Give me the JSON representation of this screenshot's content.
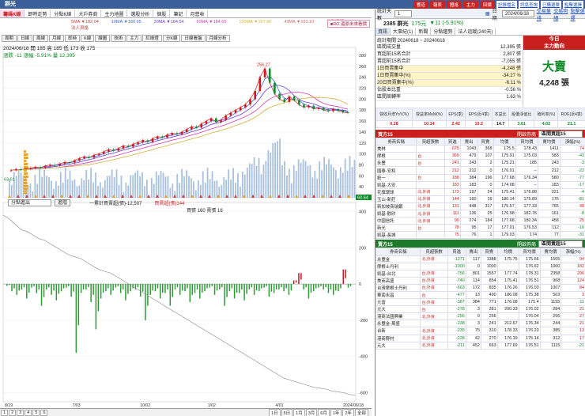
{
  "window": {
    "title": "群光"
  },
  "top_menu": {
    "buttons": [
      "響道",
      "報表",
      "體格",
      "主力",
      "回饋"
    ],
    "links": [
      "記錄檔名",
      "訊息查詢",
      "已購選單",
      "點擊選擇"
    ]
  },
  "tabs": [
    "籌碼K線",
    "即時走勢",
    "分點K線",
    "大戶券商",
    "主力地圖",
    "選股分析",
    "個股",
    "筆記",
    "月營收"
  ],
  "ma_legend": [
    {
      "label": "5MA ▼182.04",
      "color": "#d43a3a"
    },
    {
      "label": "10MA ▼180.95",
      "color": "#3a6ad4"
    },
    {
      "label": "20MA ▼184.54",
      "color": "#6a3ad4"
    },
    {
      "label": "60MA ▼184.65",
      "color": "#d43ab0"
    },
    {
      "label": "120MA ▼167.60",
      "color": "#d4b03a"
    },
    {
      "label": "43MA ▼183.10",
      "color": "#c86a6a"
    },
    {
      "label": "地點選擇",
      "color": "#c04040"
    },
    {
      "label": "法人資格",
      "color": "#c04040"
    }
  ],
  "ma_badge": "■RO 還原未來看價",
  "tools": [
    "周期",
    "日線",
    "周線",
    "月線",
    "即時",
    "K線",
    "線圖",
    "技術",
    "主力",
    "紅綠燈",
    "分K線",
    "日線看盤",
    "月線分析"
  ],
  "info": {
    "line1": "2024/06/18 開 185 高 185 低 173 收 175",
    "line2_prefix": "漲跌 -11 漲幅 -5.91% 量 12,395"
  },
  "chart_data": {
    "type": "line",
    "title": "",
    "x_ticks": [
      "8/19",
      "7/03",
      "10/02",
      "1/02",
      "4/01",
      "2024/06/18"
    ],
    "x_tick_year": [
      "2023",
      "",
      "",
      "2024",
      "",
      ""
    ],
    "y_ticks_price": [
      280,
      260,
      240,
      220,
      200,
      180,
      160,
      140,
      120,
      100,
      80,
      60,
      40,
      20
    ],
    "y_ticks_flow": [
      400,
      200,
      0,
      -200,
      -400,
      -600
    ],
    "peak_label": "256.27",
    "low_label": "63.51",
    "last_label": "60.64",
    "price": [
      70,
      72,
      71,
      73,
      74,
      76,
      75,
      78,
      80,
      79,
      82,
      85,
      84,
      88,
      92,
      95,
      93,
      98,
      100,
      104,
      108,
      106,
      110,
      115,
      113,
      118,
      121,
      125,
      122,
      128,
      132,
      130,
      135,
      138,
      136,
      140,
      145,
      150,
      148,
      155,
      160,
      165,
      158,
      162,
      170,
      175,
      180,
      185,
      190,
      200,
      215,
      240,
      256,
      230,
      210,
      200,
      195,
      205,
      198,
      190,
      185,
      188,
      182,
      184,
      180,
      178,
      182,
      179,
      176,
      175
    ],
    "volume_in_price_pane": true,
    "flow_label": "一累計買賣超(張)-12,507",
    "flow_sub": "買張 160 賣張 16",
    "flow_series": "買賣超(張)144",
    "cum_flow": [
      380,
      360,
      330,
      300,
      290,
      270,
      250,
      240,
      220,
      200,
      180,
      160,
      150,
      140,
      120,
      100,
      80,
      70,
      60,
      40,
      20,
      0,
      -20,
      -40,
      -60,
      -80,
      -100,
      -120,
      -140,
      -160,
      -180,
      -200,
      -220,
      -240,
      -260,
      -280,
      -300,
      -320,
      -340,
      -360,
      -380,
      -400,
      -420,
      -440,
      -460,
      -480,
      -500,
      -520,
      -530,
      -540,
      -550,
      -560,
      -570,
      -575,
      -580,
      -590,
      -595,
      -600,
      -610,
      -615
    ],
    "daily_flow": [
      -10,
      -40,
      -60,
      -30,
      -80,
      -20,
      -50,
      -120,
      -30,
      -60,
      -90,
      -40,
      -20,
      -70,
      -380,
      -50,
      -30,
      -100,
      -250,
      -80,
      -40,
      -60,
      -20,
      -50,
      -90,
      -40,
      -30,
      -70,
      -200,
      -60,
      -40,
      -80,
      -50,
      -120,
      -30,
      -60,
      -40,
      -100,
      -50,
      -80,
      -40,
      -20,
      -60,
      -30,
      -120,
      -40,
      -80,
      -50,
      -90,
      -30,
      -60,
      -40,
      -20,
      -70,
      -50,
      -30,
      -40,
      -60,
      20,
      60,
      -30,
      -80,
      -40,
      -20,
      -30,
      -50,
      -60,
      -40,
      80,
      -20
    ]
  },
  "indicator_select": "分點進出",
  "indicator_btn": "進階",
  "bottom_pages": [
    "1",
    "2",
    "3",
    "4",
    "5",
    "6"
  ],
  "bottom_right": [
    "1日",
    "5日",
    "1月",
    "3月",
    "6月",
    "1年",
    "2年",
    "全部"
  ],
  "right": {
    "stats_label": "統計天數",
    "stats_days": "1",
    "date_label": "日期",
    "date_value": "2024/06/18",
    "links": [
      "交易量排",
      "交易明細",
      "點擊選擇"
    ],
    "stock_title": "2385 群光",
    "stock_price": "175元",
    "stock_change": "▼11 (-5.91%)",
    "sub_tabs": [
      "資訊",
      "大事紀(1)",
      "新聞",
      "分點趨勢",
      "法人追蹤(240天)"
    ],
    "summary_head": "統計期間  20240618 ~ 20240618",
    "summary": [
      {
        "label": "區間成交量",
        "value": "12,395 張"
      },
      {
        "label": "買超前15名合計",
        "value": "2,807 張"
      },
      {
        "label": "賣超前15名合計",
        "value": "-7,055 張"
      },
      {
        "label": "1日買賣集中",
        "value": "-4,248 張"
      },
      {
        "label": "1日買賣集中(%)",
        "value": "-34.27 %"
      },
      {
        "label": "20日買賣集中(%)",
        "value": "-6.11 %"
      },
      {
        "label": "佔股本比重",
        "value": "-0.56 %"
      },
      {
        "label": "區間周轉率",
        "value": "1.63 %"
      }
    ],
    "today_label": "今日",
    "main_label": "主力動向",
    "verdict": "大賣",
    "verdict_value": "4,248 張",
    "metrics_heads": [
      "營收月增YoY(%)",
      "營益率MoM(%)",
      "EPS(季)",
      "EPS(近4季)",
      "本益比",
      "股價淨值比",
      "殖利率(%)",
      "ROE(近4季)"
    ],
    "metrics_values": [
      "0.28",
      "10.14",
      "2.42",
      "10.2",
      "14.7",
      "3.61",
      "4.02",
      "21.1"
    ],
    "buy_title": "買方15",
    "sell_title": "賣方15",
    "select_label": "開啟券商",
    "select_value": "區間買超15",
    "select_value_sell": "區間賣超15",
    "table_heads": [
      "券商名稱",
      "買超張數",
      "買進",
      "賣出",
      "買賣",
      "均價",
      "買均價",
      "賣均價",
      "漲幅(%)"
    ],
    "buys": [
      [
        "美林",
        "",
        "675",
        "1043",
        "368",
        "175.5",
        "178.43",
        "1411",
        "74"
      ],
      [
        "摩根",
        "台",
        "369",
        "479",
        "107",
        "175.91",
        "175.03",
        "583",
        "-43"
      ],
      [
        "永豐",
        "台",
        "241",
        "243",
        "2",
        "175.21",
        "185",
        "243",
        "-3"
      ],
      [
        "國泰-安和",
        "",
        "212",
        "212",
        "0",
        "176.01",
        "--",
        "212",
        "-22"
      ],
      [
        "統一",
        "台",
        "188",
        "384",
        "196",
        "177.68",
        "176.34",
        "580",
        "-77"
      ],
      [
        "凱基-大安",
        "",
        "183",
        "183",
        "0",
        "174.08",
        "--",
        "183",
        "-17"
      ],
      [
        "花旗環球",
        "北,外資",
        "173",
        "197",
        "24",
        "175.41",
        "176.88",
        "221",
        "-4"
      ],
      [
        "玉山-新莊",
        "北,外資",
        "144",
        "160",
        "16",
        "180.14",
        "175.89",
        "176",
        "-81"
      ],
      [
        "新加坡商瑞銀",
        "北,外資",
        "131",
        "448",
        "317",
        "175.57",
        "177.33",
        "765",
        "48"
      ],
      [
        "凱基-歡欣",
        "北,外資",
        "111",
        "136",
        "25",
        "176.98",
        "182.76",
        "161",
        "-8"
      ],
      [
        "中國信託",
        "北,外資",
        "90",
        "274",
        "184",
        "177.68",
        "180.34",
        "458",
        "25"
      ],
      [
        "新光",
        "台",
        "78",
        "95",
        "17",
        "177.01",
        "176.53",
        "112",
        "-16"
      ],
      [
        "凱基-長城",
        "",
        "75",
        "76",
        "1",
        "179.03",
        "174",
        "77",
        "-31"
      ]
    ],
    "sells": [
      [
        "永豐金",
        "北,外資",
        "-1271",
        "117",
        "1388",
        "175.75",
        "175.66",
        "1505",
        "94"
      ],
      [
        "摩根士丹利",
        "",
        "-1000",
        "0",
        "1000",
        "",
        "176.62",
        "1000",
        "182"
      ],
      [
        "凱基-台北",
        "台,外資",
        "-756",
        "801",
        "1557",
        "177.74",
        "178.31",
        "2358",
        "296"
      ],
      [
        "美商高盛",
        "台,外資",
        "-740",
        "114",
        "854",
        "175.41",
        "176.51",
        "968",
        "124"
      ],
      [
        "台灣摩根士丹利",
        "台,外資",
        "-663",
        "172",
        "835",
        "176.26",
        "176.03",
        "1007",
        "84"
      ],
      [
        "華南永昌",
        "台",
        "-477",
        "13",
        "490",
        "186.08",
        "175.38",
        "503",
        "3"
      ],
      [
        "元富",
        "台,外資",
        "-387",
        "384",
        "771",
        "176.08",
        "175.4",
        "1155",
        "-11"
      ],
      [
        "元大",
        "台",
        "-278",
        "3",
        "281",
        "200.33",
        "176.02",
        "284",
        "21"
      ],
      [
        "港商法國興業",
        "北,外資",
        "-256",
        "0",
        "256",
        "",
        "176.04",
        "256",
        "27"
      ],
      [
        "永豐金-萬盛",
        "",
        "-238",
        "3",
        "241",
        "212.67",
        "176.34",
        "244",
        "21"
      ],
      [
        "台新",
        "北,外資",
        "-235",
        "75",
        "310",
        "178.33",
        "176.23",
        "385",
        "13"
      ],
      [
        "港商野村",
        "北,外資",
        "-228",
        "42",
        "270",
        "176.19",
        "175.14",
        "312",
        "17"
      ],
      [
        "元大",
        "北,外資",
        "-211",
        "452",
        "663",
        "177.69",
        "176.51",
        "1115",
        "-21"
      ]
    ]
  }
}
